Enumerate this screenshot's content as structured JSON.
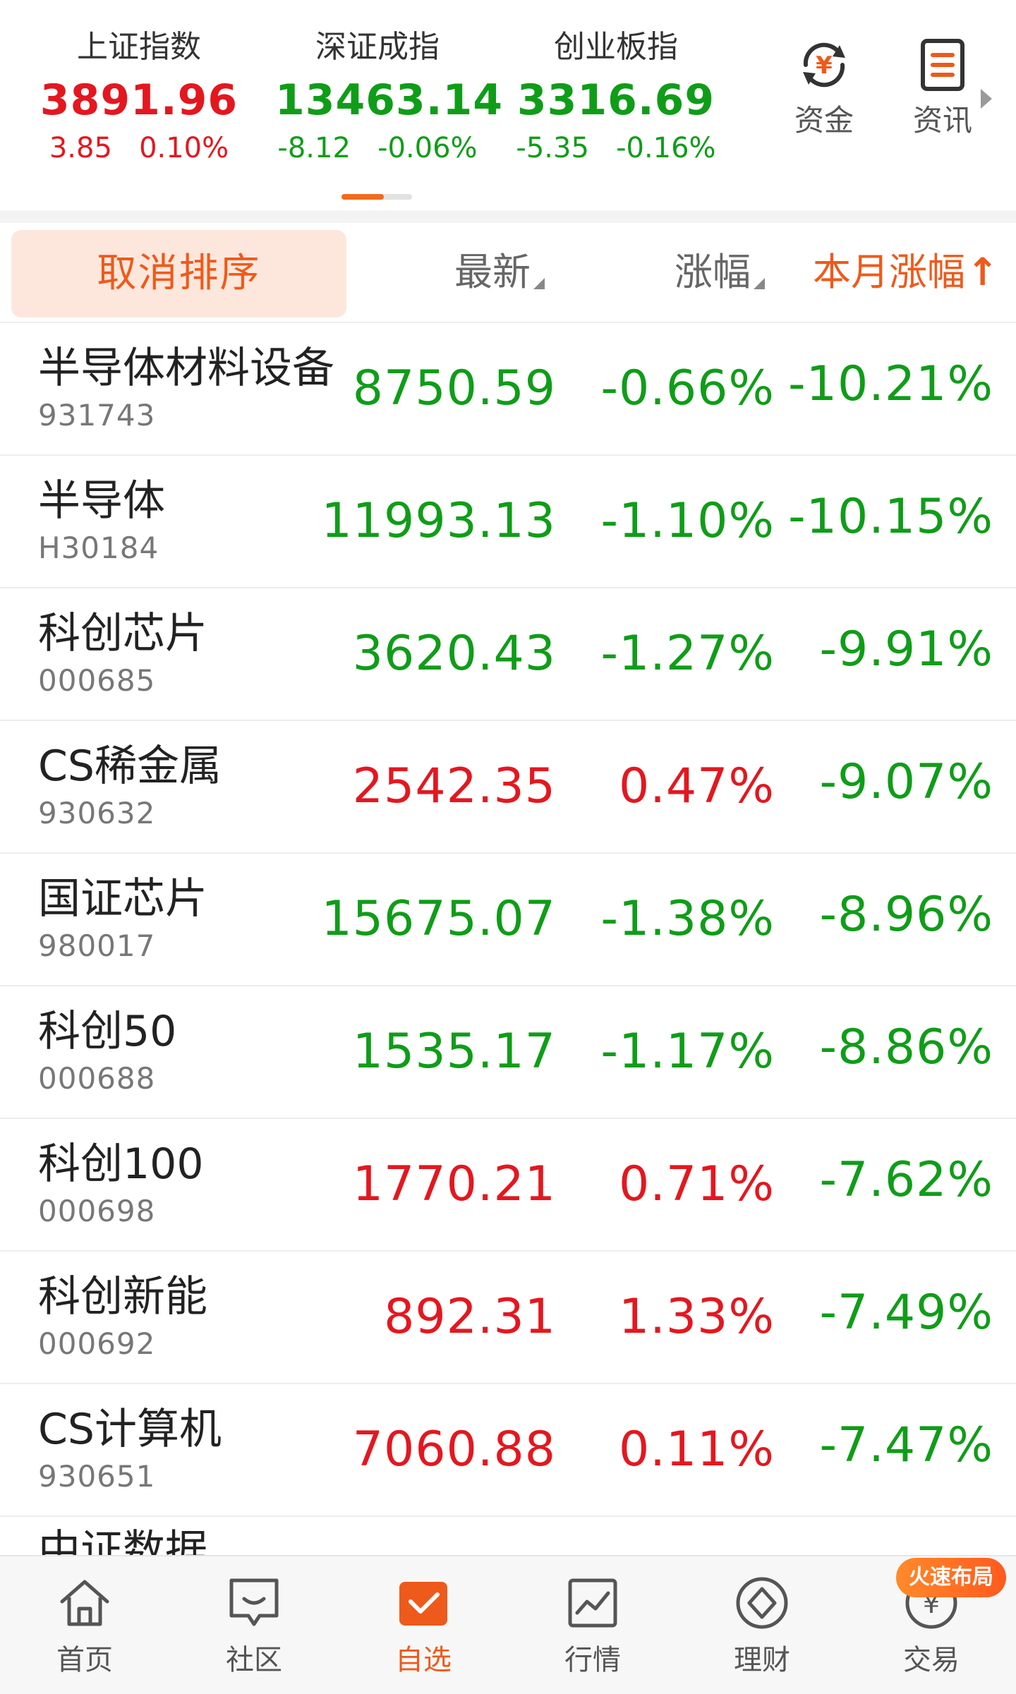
{
  "indices": [
    {
      "name": "上证指数",
      "value": "3891.96",
      "change": "3.85",
      "pct": "0.10%",
      "trend": "up"
    },
    {
      "name": "深证成指",
      "value": "13463.14",
      "change": "-8.12",
      "pct": "-0.06%",
      "trend": "down"
    },
    {
      "name": "创业板指",
      "value": "3316.69",
      "change": "-5.35",
      "pct": "-0.16%",
      "trend": "down"
    }
  ],
  "quick_links": [
    {
      "label": "资金",
      "icon": "yuan-arrows-icon"
    },
    {
      "label": "资讯",
      "icon": "news-icon"
    }
  ],
  "header": {
    "cancel_sort": "取消排序",
    "col_latest": "最新",
    "col_change": "涨幅",
    "col_month": "本月涨幅",
    "month_sort_arrow": "↑"
  },
  "rows": [
    {
      "name": "半导体材料设备",
      "code": "931743",
      "latest": "8750.59",
      "change": "-0.66%",
      "month": "-10.21%",
      "trend": "down",
      "month_trend": "down"
    },
    {
      "name": "半导体",
      "code": "H30184",
      "latest": "11993.13",
      "change": "-1.10%",
      "month": "-10.15%",
      "trend": "down",
      "month_trend": "down"
    },
    {
      "name": "科创芯片",
      "code": "000685",
      "latest": "3620.43",
      "change": "-1.27%",
      "month": "-9.91%",
      "trend": "down",
      "month_trend": "down"
    },
    {
      "name": "CS稀金属",
      "code": "930632",
      "latest": "2542.35",
      "change": "0.47%",
      "month": "-9.07%",
      "trend": "up",
      "month_trend": "down"
    },
    {
      "name": "国证芯片",
      "code": "980017",
      "latest": "15675.07",
      "change": "-1.38%",
      "month": "-8.96%",
      "trend": "down",
      "month_trend": "down"
    },
    {
      "name": "科创50",
      "code": "000688",
      "latest": "1535.17",
      "change": "-1.17%",
      "month": "-8.86%",
      "trend": "down",
      "month_trend": "down"
    },
    {
      "name": "科创100",
      "code": "000698",
      "latest": "1770.21",
      "change": "0.71%",
      "month": "-7.62%",
      "trend": "up",
      "month_trend": "down"
    },
    {
      "name": "科创新能",
      "code": "000692",
      "latest": "892.31",
      "change": "1.33%",
      "month": "-7.49%",
      "trend": "up",
      "month_trend": "down"
    },
    {
      "name": "CS计算机",
      "code": "930651",
      "latest": "7060.88",
      "change": "0.11%",
      "month": "-7.47%",
      "trend": "up",
      "month_trend": "down"
    }
  ],
  "partial_row_name": "中证数据",
  "nav": [
    {
      "label": "首页",
      "icon": "home-icon"
    },
    {
      "label": "社区",
      "icon": "chat-icon"
    },
    {
      "label": "自选",
      "icon": "favorites-check-icon",
      "active": true
    },
    {
      "label": "行情",
      "icon": "trend-chart-icon"
    },
    {
      "label": "理财",
      "icon": "diamond-icon"
    },
    {
      "label": "交易",
      "icon": "yuan-circle-icon"
    }
  ],
  "badge": "火速布局",
  "colors": {
    "up": "#e4171f",
    "down": "#0f9d18",
    "accent": "#ee5a1b"
  }
}
